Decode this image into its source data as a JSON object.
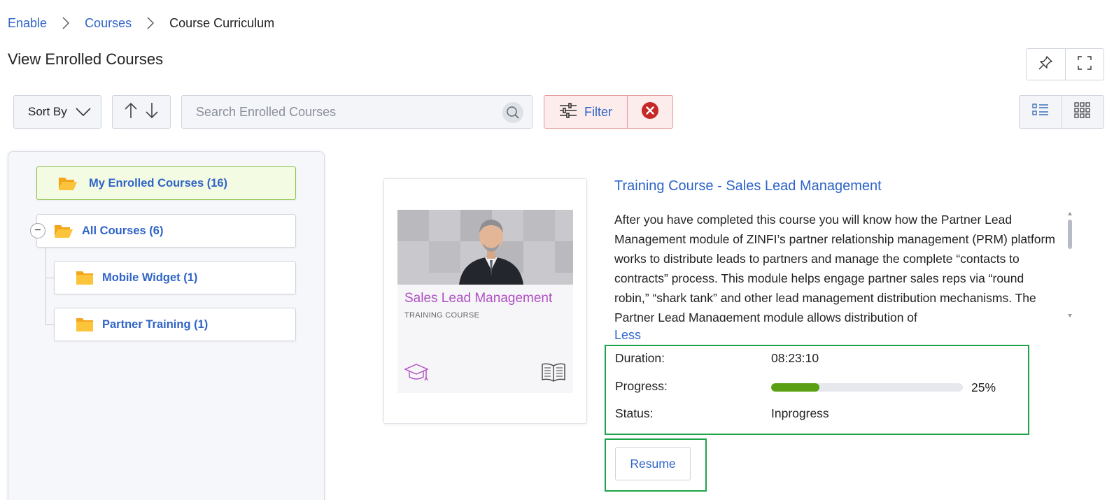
{
  "breadcrumb": {
    "items": [
      "Enable",
      "Courses"
    ],
    "current": "Course Curriculum"
  },
  "page": {
    "title": "View Enrolled Courses"
  },
  "toolbar": {
    "sort_label": "Sort By",
    "search_placeholder": "Search Enrolled Courses",
    "filter_label": "Filter"
  },
  "sidebar": {
    "root": "My Enrolled Courses (16)",
    "all": "All Courses (6)",
    "children": [
      "Mobile Widget (1)",
      "Partner Training (1)"
    ]
  },
  "course": {
    "card_title": "Sales Lead Management",
    "card_type": "TRAINING COURSE",
    "title": "Training Course - Sales Lead Management",
    "description": "After you have completed this course you will know how the Partner Lead Management module of ZINFI’s partner relationship management (PRM) platform works to distribute leads to partners and manage the complete “contacts to contracts” process. This module helps engage partner sales reps via “round robin,” “shark tank” and other lead management distribution mechanisms. The Partner Lead Management module allows distribution of",
    "less_label": "Less",
    "duration_label": "Duration:",
    "duration": "08:23:10",
    "progress_label": "Progress:",
    "progress_value": 0.25,
    "progress_text": "25%",
    "status_label": "Status:",
    "status": "Inprogress",
    "resume_label": "Resume"
  },
  "colors": {
    "link": "#2f64c8",
    "progress": "#5aa012",
    "highlight_box": "#1fa34a",
    "card_title": "#b04fc4"
  },
  "icons": [
    "chevron-right-icon",
    "pin-icon",
    "fullscreen-icon",
    "chevron-down-icon",
    "sort-up-icon",
    "sort-down-icon",
    "search-icon",
    "filter-sliders-icon",
    "clear-filter-icon",
    "list-view-icon",
    "grid-view-icon",
    "folder-open-icon",
    "folder-icon",
    "graduation-cap-icon",
    "book-icon"
  ]
}
